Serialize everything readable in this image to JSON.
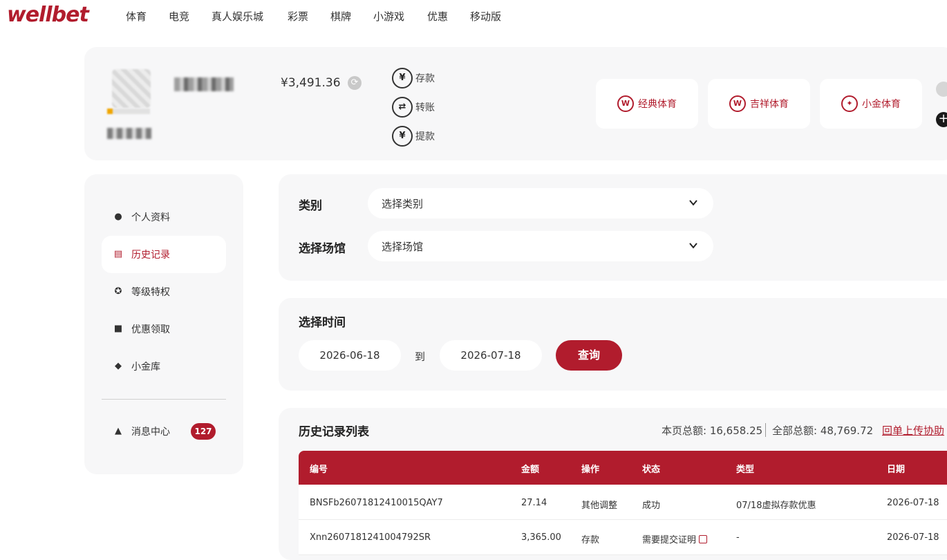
{
  "nav": {
    "logo": "wellbet",
    "items": [
      "体育",
      "电竞",
      "真人娱乐城",
      "彩票",
      "棋牌",
      "小游戏",
      "优惠",
      "移动版"
    ]
  },
  "account": {
    "balance": "¥3,491.36",
    "actions": [
      "存款",
      "转账",
      "提款"
    ],
    "venues": [
      "经典体育",
      "吉祥体育",
      "小金体育"
    ]
  },
  "sidebar": {
    "items": [
      "个人资料",
      "历史记录",
      "等级特权",
      "优惠领取",
      "小金库"
    ],
    "messages_label": "消息中心",
    "messages_count": "127"
  },
  "filters": {
    "category_label": "类别",
    "category_value": "选择类别",
    "venue_label": "选择场馆",
    "venue_value": "选择场馆"
  },
  "time": {
    "label": "选择时间",
    "from": "2026-06-18",
    "to_label": "到",
    "to": "2026-07-18",
    "query_label": "查询"
  },
  "history": {
    "title": "历史记录列表",
    "page_total": "本页总额: 16,658.25",
    "all_total": "全部总额: 48,769.72",
    "help_link": "回单上传协助",
    "columns": [
      "编号",
      "金额",
      "操作",
      "状态",
      "类型",
      "日期"
    ],
    "rows": [
      [
        "BNSFb26071812410015QAY7",
        "27.14",
        "其他调整",
        "成功",
        "07/18虚拟存款优惠",
        "2026-07-18"
      ],
      [
        "Xnn2607181241004792SR",
        "3,365.00",
        "存款",
        "需要提交证明",
        "-",
        "2026-07-18"
      ]
    ]
  },
  "colors": {
    "brand": "#b11c2d",
    "panel": "#f7f7f8"
  }
}
